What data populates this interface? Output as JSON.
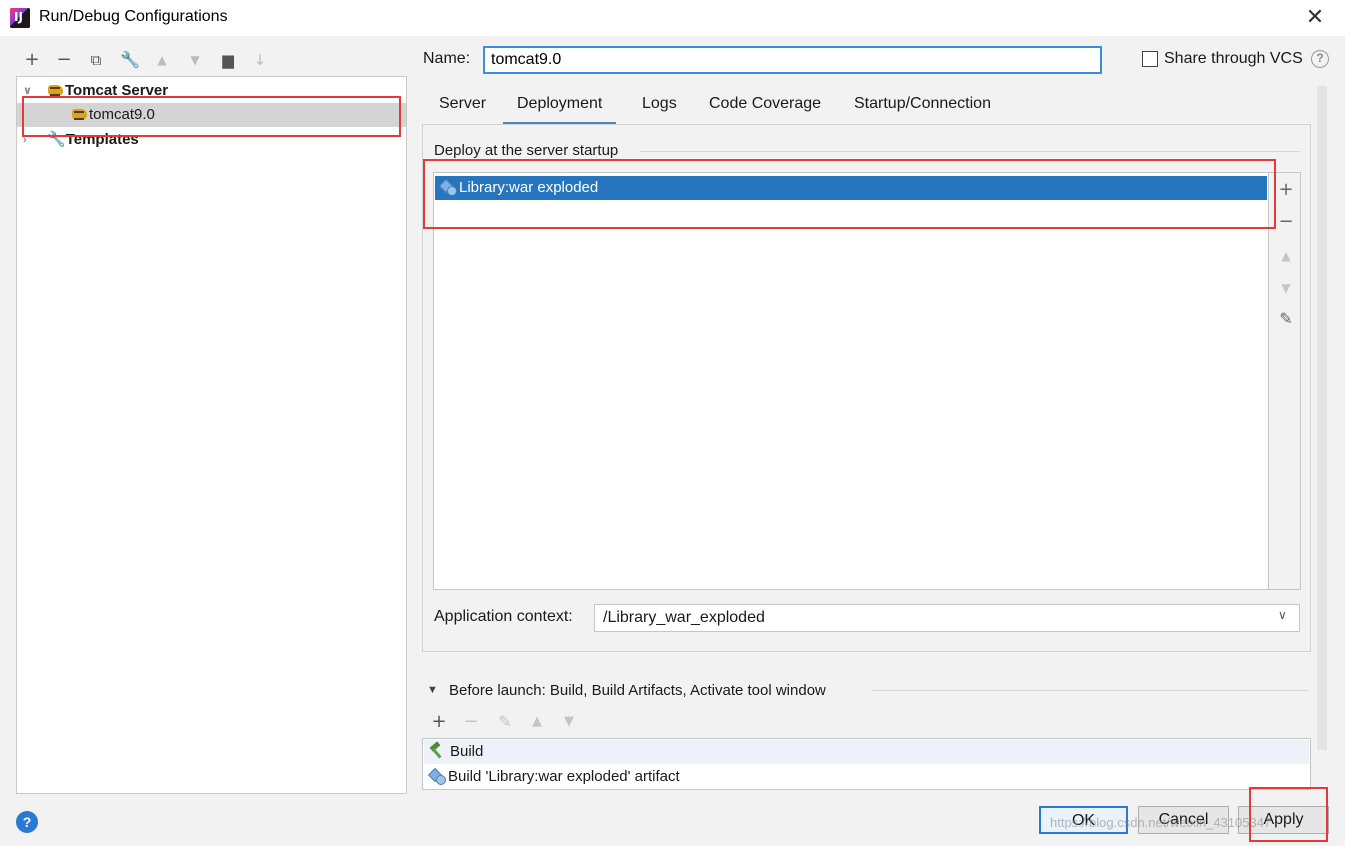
{
  "window": {
    "title": "Run/Debug Configurations",
    "close_glyph": "✕"
  },
  "left_toolbar": {
    "icons": [
      "add-icon",
      "remove-icon",
      "copy-icon",
      "wrench-icon",
      "move-up-icon",
      "move-down-icon",
      "folder-add-icon",
      "sort-icon"
    ]
  },
  "tree": {
    "group_label": "Tomcat Server",
    "config_label": "tomcat9.0",
    "templates_label": "Templates"
  },
  "name_field": {
    "label": "Name:",
    "value": "tomcat9.0"
  },
  "share": {
    "label": "Share through VCS",
    "checked": false,
    "help_glyph": "?"
  },
  "tabs": [
    {
      "label": "Server",
      "active": false
    },
    {
      "label": "Deployment",
      "active": true
    },
    {
      "label": "Logs",
      "active": false
    },
    {
      "label": "Code Coverage",
      "active": false
    },
    {
      "label": "Startup/Connection",
      "active": false
    }
  ],
  "deployment": {
    "section_title": "Deploy at the server startup",
    "items": [
      "Library:war exploded"
    ],
    "side_icons": [
      "add-icon",
      "remove-icon",
      "move-up-icon",
      "move-down-icon",
      "edit-icon"
    ],
    "app_context_label": "Application context:",
    "app_context_value": "/Library_war_exploded"
  },
  "before_launch": {
    "label": "Before launch: Build, Build Artifacts, Activate tool window",
    "tasks": [
      "Build",
      "Build 'Library:war exploded' artifact"
    ]
  },
  "buttons": {
    "ok": "OK",
    "cancel": "Cancel",
    "apply": "Apply",
    "help": "?"
  },
  "watermark": "https://blog.csdn.net/weixin_43105347",
  "colors": {
    "selection": "#2675bf",
    "highlight": "#e03c3c",
    "accent": "#2a7ad5"
  }
}
